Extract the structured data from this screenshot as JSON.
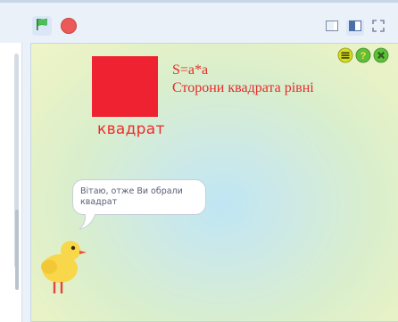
{
  "toolbar": {
    "green_flag_icon": "green-flag-icon",
    "stop_icon": "stop-icon",
    "view_buttons": [
      "small-stage-icon",
      "normal-stage-icon",
      "fullscreen-icon"
    ]
  },
  "stage": {
    "square_label": "квадрат",
    "formula": "S=a*a",
    "sides_text": "Сторони квадрата рівні",
    "speech_bubble": "Вітаю, отже Ви обрали квадрат",
    "corner_icons": [
      "menu-icon",
      "help-icon",
      "close-icon"
    ]
  },
  "colors": {
    "accent_red": "#ee2230",
    "text_red": "#e42b2b",
    "flag_green": "#4cbf56",
    "stop_red": "#ec5959"
  }
}
